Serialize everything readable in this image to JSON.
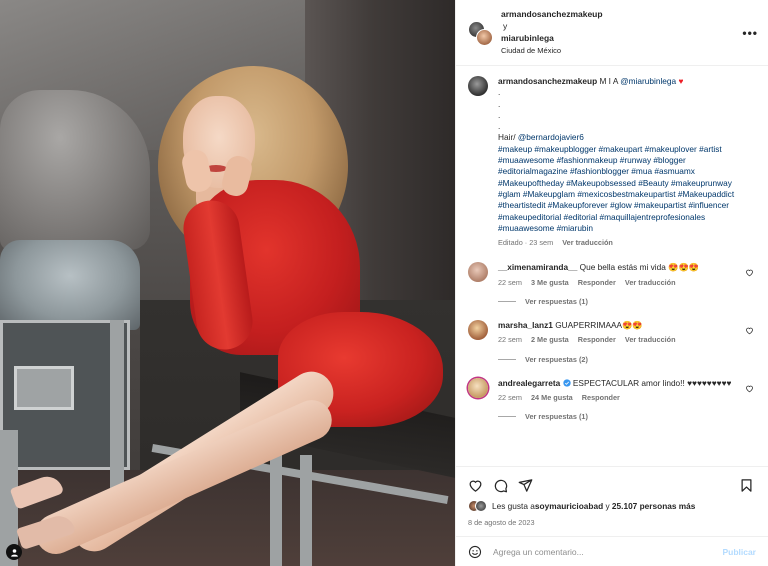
{
  "header": {
    "user1": "armandosanchezmakeup",
    "conjunction": "y",
    "user2": "miarubinlega",
    "location": "Ciudad de México",
    "more_icon": "more-options-icon"
  },
  "caption": {
    "username": "armandosanchezmakeup",
    "intro": "M I A",
    "mention": "@miarubinlega",
    "heart": "♥",
    "dots": [
      ".",
      ".",
      ".",
      "."
    ],
    "hair_label": "Hair/",
    "hair_mention": "@bernardojavier6",
    "hashtags": "#makeup #makeupblogger #makeupart #makeuplover #artist #muaawesome #fashionmakeup #runway #blogger #editorialmagazine #fashionblogger #mua #asmuamx #Makeupoftheday #Makeupobsessed #Beauty #makeuprunway #glam #Makeupglam #mexicosbestmakeupartist #Makeupaddict #theartistedit #Makeupforever #glow #makeupartist #influencer #makeupeditorial #editorial #maquillajentreprofesionales #muaawesome #miarubin",
    "edited": "Editado · 23 sem",
    "translate": "Ver traducción"
  },
  "comments": [
    {
      "username": "__ximenamiranda__",
      "text": "Que bella estás mi vida 😍😍😍",
      "age": "22 sem",
      "likes": "3 Me gusta",
      "reply": "Responder",
      "translate": "Ver traducción",
      "view_replies": "Ver respuestas (1)"
    },
    {
      "username": "marsha_lanz1",
      "text": "GUAPERRIMAAA😍😍",
      "age": "22 sem",
      "likes": "2 Me gusta",
      "reply": "Responder",
      "translate": "Ver traducción",
      "view_replies": "Ver respuestas (2)"
    },
    {
      "username": "andrealegarreta",
      "text": "ESPECTACULAR amor lindo!! ♥♥♥♥♥♥♥♥♥",
      "age": "22 sem",
      "likes": "24 Me gusta",
      "reply": "Responder",
      "translate": "",
      "view_replies": "Ver respuestas (1)"
    }
  ],
  "likes": {
    "prefix": "Les gusta a ",
    "user": "soymauricioabad",
    "middle": " y ",
    "count": "25.107 personas más"
  },
  "date": "8 de agosto de 2023",
  "add_comment": {
    "placeholder": "Agrega un comentario...",
    "publish": "Publicar"
  },
  "colors": {
    "accent_link": "#00376b",
    "verified": "#3897f0",
    "heart": "#ed1c24",
    "publish_disabled": "#b3dbff"
  }
}
